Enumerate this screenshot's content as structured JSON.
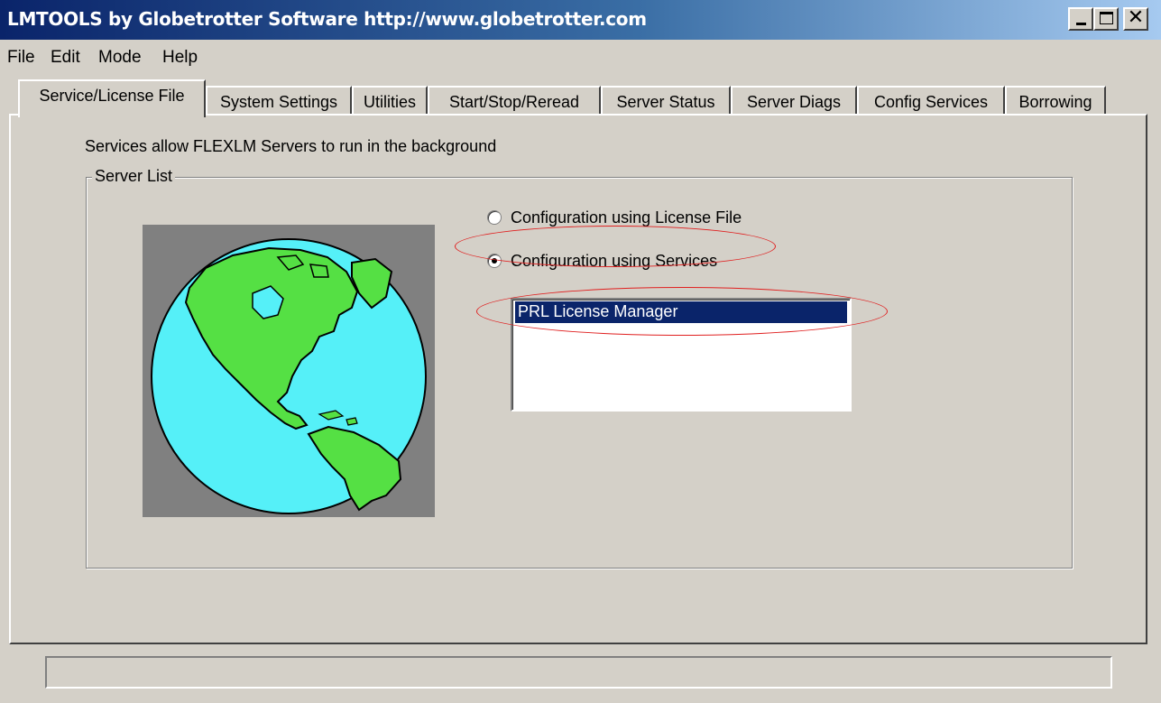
{
  "window": {
    "title": "LMTOOLS by Globetrotter Software http://www.globetrotter.com",
    "close_glyph": "✕"
  },
  "menu": {
    "items": [
      "File",
      "Edit",
      "Mode",
      "Help"
    ]
  },
  "tabs": [
    {
      "label": "Service/License File",
      "active": true
    },
    {
      "label": "System Settings",
      "active": false
    },
    {
      "label": "Utilities",
      "active": false
    },
    {
      "label": "Start/Stop/Reread",
      "active": false
    },
    {
      "label": "Server Status",
      "active": false
    },
    {
      "label": "Server Diags",
      "active": false
    },
    {
      "label": "Config Services",
      "active": false
    },
    {
      "label": "Borrowing",
      "active": false
    }
  ],
  "panel": {
    "description": "Services allow FLEXLM Servers to run in the background",
    "group_label": "Server List",
    "radios": [
      {
        "label": "Configuration using License File",
        "checked": false
      },
      {
        "label": "Configuration using Services",
        "checked": true
      }
    ],
    "services_list": {
      "items": [
        "PRL License Manager"
      ],
      "selected": "PRL License Manager"
    }
  },
  "status_bar": {
    "text": ""
  },
  "colors": {
    "annotation": "#e02020",
    "selection": "#0a246a",
    "ocean": "#55f0f8",
    "land": "#55e044",
    "globe_bg": "#808080"
  },
  "icons": {
    "globe": "globe-icon"
  }
}
